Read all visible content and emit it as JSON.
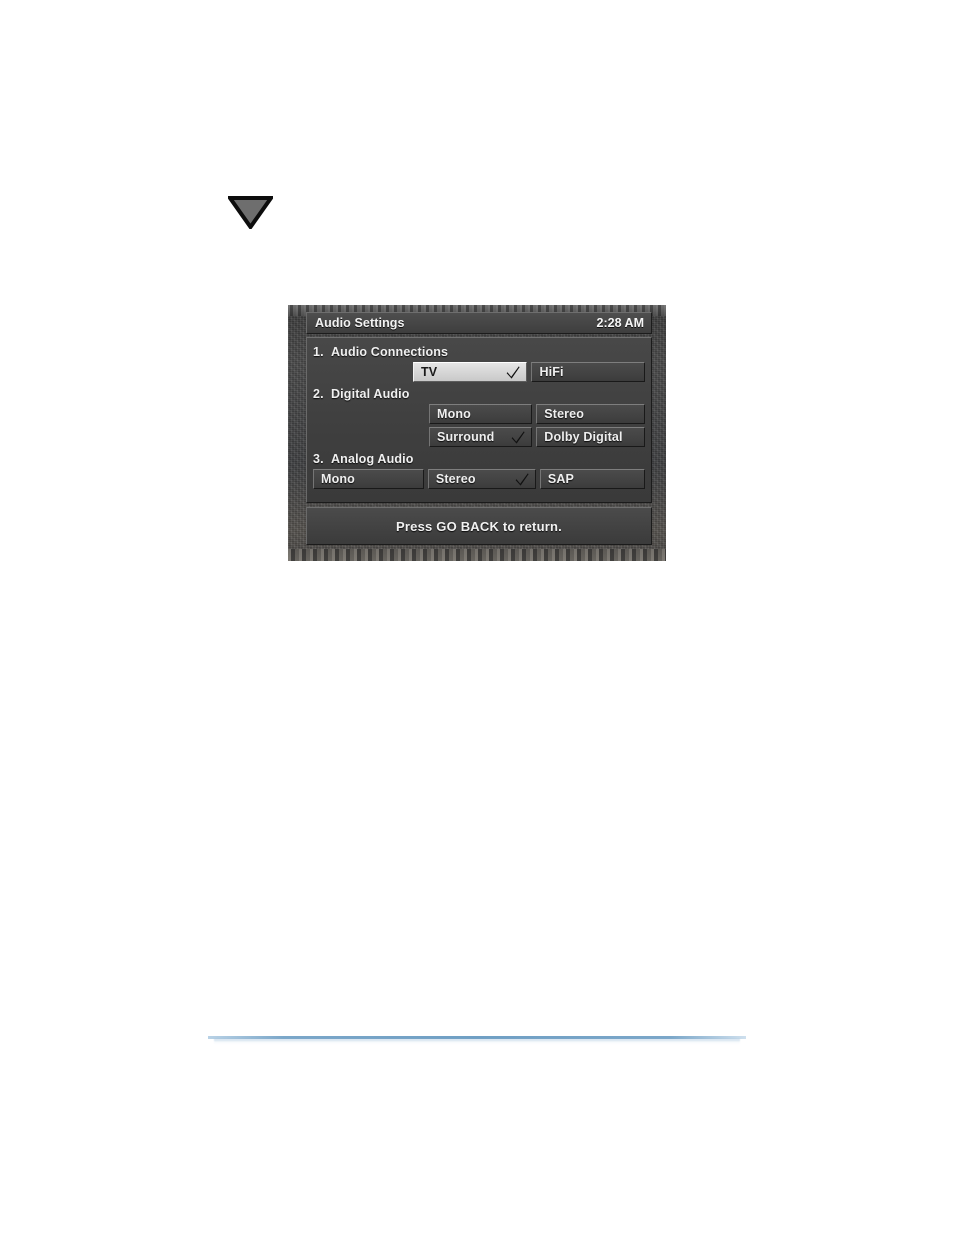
{
  "page": {
    "background_color": "#ffffff",
    "triangle_icon": "triangle-down-icon",
    "rule_color": "#7ba7c9"
  },
  "osd": {
    "title": "Audio Settings",
    "clock": "2:28 AM",
    "footer": "Press GO BACK to return.",
    "colors": {
      "panel": "#414141",
      "selected_bg": "#d8d8d8",
      "text": "#f0f0f0"
    },
    "sections": [
      {
        "number": "1.",
        "label": "Audio Connections",
        "rows": [
          {
            "options": [
              {
                "label": "TV",
                "checked": true,
                "selected": true
              },
              {
                "label": "HiFi",
                "checked": false,
                "selected": false
              }
            ]
          }
        ]
      },
      {
        "number": "2.",
        "label": "Digital Audio",
        "rows": [
          {
            "options": [
              {
                "label": "Mono",
                "checked": false,
                "selected": false
              },
              {
                "label": "Stereo",
                "checked": false,
                "selected": false
              }
            ]
          },
          {
            "options": [
              {
                "label": "Surround",
                "checked": true,
                "selected": false
              },
              {
                "label": "Dolby Digital",
                "checked": false,
                "selected": false
              }
            ]
          }
        ]
      },
      {
        "number": "3.",
        "label": "Analog Audio",
        "rows": [
          {
            "options": [
              {
                "label": "Mono",
                "checked": false,
                "selected": false
              },
              {
                "label": "Stereo",
                "checked": true,
                "selected": false
              },
              {
                "label": "SAP",
                "checked": false,
                "selected": false
              }
            ]
          }
        ]
      }
    ]
  }
}
